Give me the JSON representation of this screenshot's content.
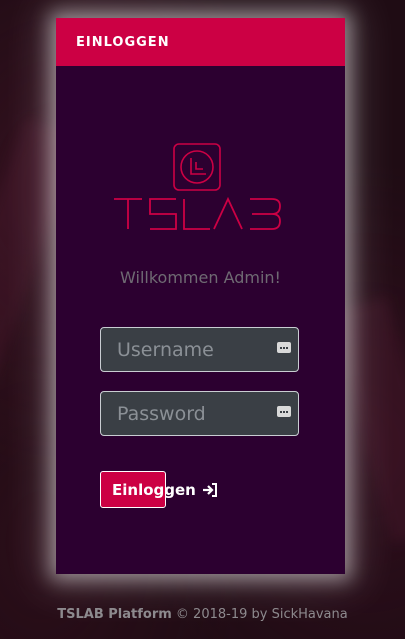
{
  "header": {
    "title": "EINLOGGEN"
  },
  "logo": {
    "text": "TSLAB",
    "color": "#cc0044",
    "icon": "tslab-logo-icon"
  },
  "welcome": "Willkommen Admin!",
  "form": {
    "username": {
      "placeholder": "Username",
      "value": "",
      "icon": "key-icon"
    },
    "password": {
      "placeholder": "Password",
      "value": "",
      "icon": "key-icon"
    },
    "submit": {
      "label": "Einloggen",
      "icon": "sign-in-icon"
    }
  },
  "footer": {
    "brand": "TSLAB Platform",
    "text": "© 2018-19 by SickHavana"
  },
  "colors": {
    "accent": "#cc0044",
    "card_bg": "#2c0030",
    "input_bg": "#3a3f45"
  }
}
